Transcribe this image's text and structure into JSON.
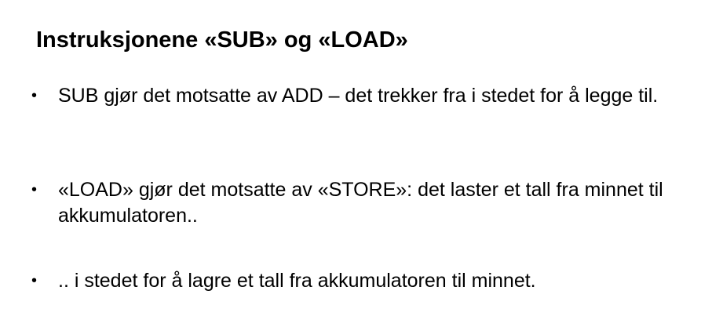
{
  "slide": {
    "title": "Instruksjonene «SUB» og «LOAD»",
    "bullet_symbol": "•",
    "bullets": [
      {
        "text": "SUB gjør det motsatte av ADD – det trekker fra i stedet for å legge til."
      },
      {
        "text": "«LOAD» gjør det motsatte av «STORE»: det laster et tall fra minnet til akkumulatoren.."
      },
      {
        "text": ".. i stedet for å lagre et tall fra akkumulatoren til minnet."
      }
    ]
  }
}
